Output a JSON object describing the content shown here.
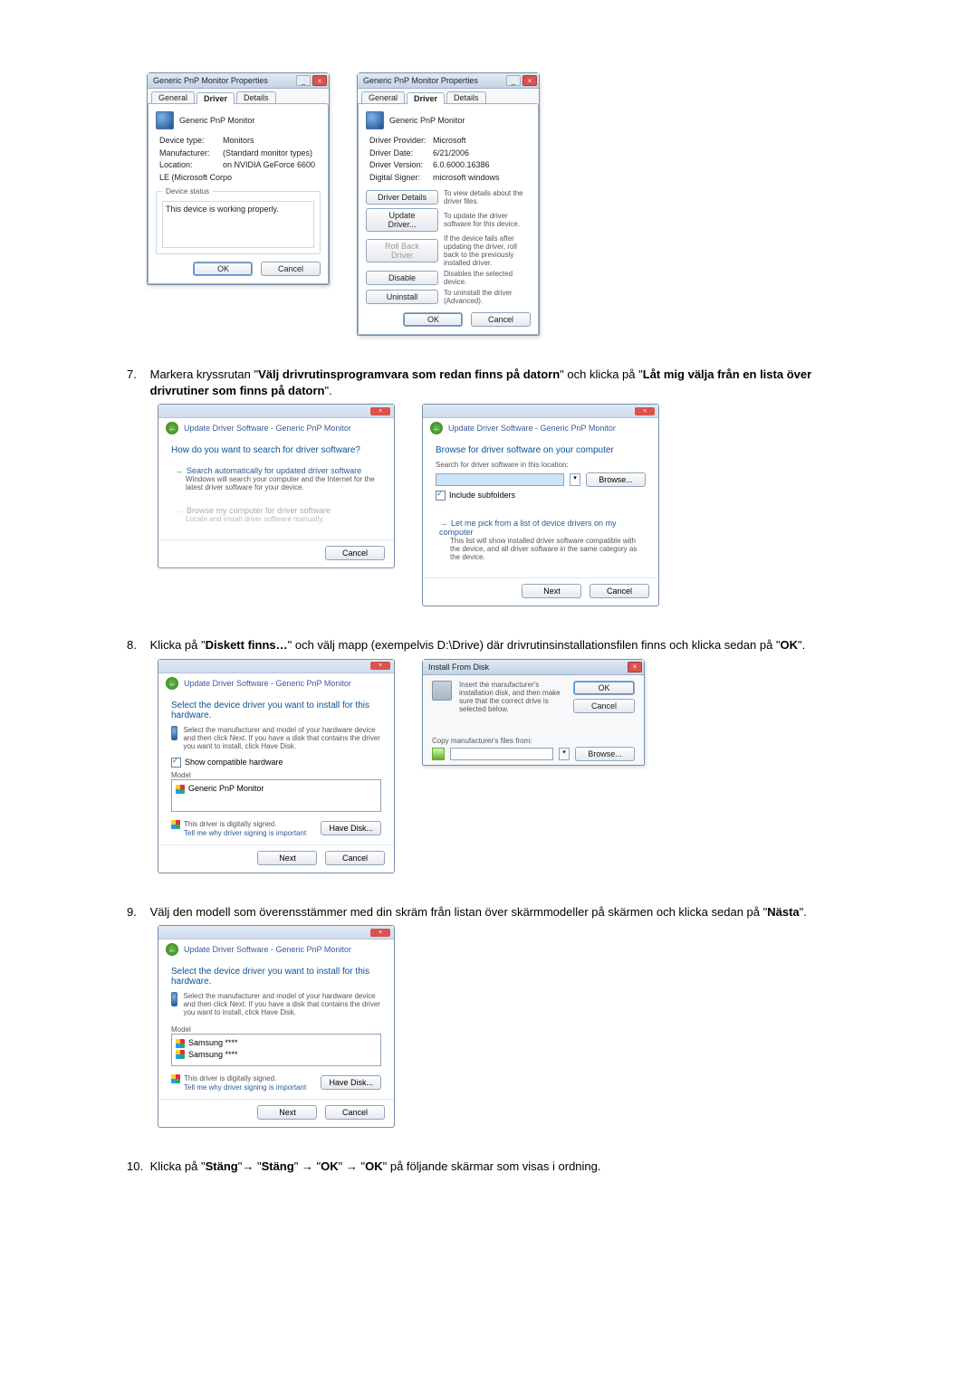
{
  "dlg_props": {
    "title": "Generic PnP Monitor Properties",
    "tabs": {
      "general": "General",
      "driver": "Driver",
      "details": "Details"
    },
    "header": "Generic PnP Monitor",
    "left": {
      "devtype_lbl": "Device type:",
      "devtype": "Monitors",
      "mfr_lbl": "Manufacturer:",
      "mfr": "(Standard monitor types)",
      "loc_lbl": "Location:",
      "loc": "on NVIDIA GeForce 6600 LE (Microsoft Corpo",
      "status_grp": "Device status",
      "status": "This device is working properly."
    },
    "right": {
      "prov_lbl": "Driver Provider:",
      "prov": "Microsoft",
      "date_lbl": "Driver Date:",
      "date": "6/21/2006",
      "ver_lbl": "Driver Version:",
      "ver": "6.0.6000.16386",
      "signer_lbl": "Digital Signer:",
      "signer": "microsoft windows",
      "btn_details": "Driver Details",
      "btn_details_desc": "To view details about the driver files.",
      "btn_update": "Update Driver...",
      "btn_update_desc": "To update the driver software for this device.",
      "btn_rollback": "Roll Back Driver",
      "btn_rollback_desc": "If the device fails after updating the driver, roll back to the previously installed driver.",
      "btn_disable": "Disable",
      "btn_disable_desc": "Disables the selected device.",
      "btn_uninstall": "Uninstall",
      "btn_uninstall_desc": "To uninstall the driver (Advanced)."
    },
    "ok": "OK",
    "cancel": "Cancel"
  },
  "step7": {
    "num": "7.",
    "text_a": "Markera kryssrutan \"",
    "bold_a": "Välj drivrutinsprogramvara som redan finns på datorn",
    "text_b": "\" och klicka på \"",
    "bold_b": "Låt mig välja från en lista över drivrutiner som finns på datorn",
    "text_c": "\"."
  },
  "wiz_left": {
    "crumb": "Update Driver Software - Generic PnP Monitor",
    "heading": "How do you want to search for driver software?",
    "opt1_title": "Search automatically for updated driver software",
    "opt1_desc": "Windows will search your computer and the Internet for the latest driver software for your device.",
    "opt2_title": "Browse my computer for driver software",
    "opt2_desc": "Locate and install driver software manually.",
    "cancel": "Cancel"
  },
  "wiz_right": {
    "crumb": "Update Driver Software - Generic PnP Monitor",
    "heading": "Browse for driver software on your computer",
    "search_lbl": "Search for driver software in this location:",
    "browse": "Browse...",
    "include": "Include subfolders",
    "opt_title": "Let me pick from a list of device drivers on my computer",
    "opt_desc": "This list will show installed driver software compatible with the device, and all driver software in the same category as the device.",
    "next": "Next",
    "cancel": "Cancel"
  },
  "step8": {
    "num": "8.",
    "text_a": "Klicka på \"",
    "bold_a": "Diskett finns…",
    "text_b": "\" och välj mapp (exempelvis D:\\Drive) där drivrutinsinstallationsfilen finns och klicka sedan på \"",
    "bold_b": "OK",
    "text_c": "\"."
  },
  "wiz_hw1": {
    "crumb": "Update Driver Software - Generic PnP Monitor",
    "heading": "Select the device driver you want to install for this hardware.",
    "desc": "Select the manufacturer and model of your hardware device and then click Next. If you have a disk that contains the driver you want to install, click Have Disk.",
    "showcompat": "Show compatible hardware",
    "model_lbl": "Model",
    "model_item": "Generic PnP Monitor",
    "signed": "This driver is digitally signed.",
    "tellwhy": "Tell me why driver signing is important",
    "havedisk": "Have Disk...",
    "next": "Next",
    "cancel": "Cancel"
  },
  "install_disk": {
    "title": "Install From Disk",
    "msg": "Insert the manufacturer's installation disk, and then make sure that the correct drive is selected below.",
    "ok": "OK",
    "cancel": "Cancel",
    "copy_lbl": "Copy manufacturer's files from:",
    "browse": "Browse..."
  },
  "step9": {
    "num": "9.",
    "text_a": "Välj den modell som överensstämmer med din skräm från listan över skärmmodeller på skärmen och klicka sedan på \"",
    "bold_a": "Nästa",
    "text_b": "\"."
  },
  "wiz_hw2": {
    "crumb": "Update Driver Software - Generic PnP Monitor",
    "heading": "Select the device driver you want to install for this hardware.",
    "desc": "Select the manufacturer and model of your hardware device and then click Next. If you have a disk that contains the driver you want to install, click Have Disk.",
    "model_lbl": "Model",
    "model_item1": "Samsung ****",
    "model_item2": "Samsung ****",
    "signed": "This driver is digitally signed.",
    "tellwhy": "Tell me why driver signing is important",
    "havedisk": "Have Disk...",
    "next": "Next",
    "cancel": "Cancel"
  },
  "step10": {
    "num": "10.",
    "text_a": "Klicka på \"",
    "b1": "Stäng",
    "arrow": "\"→ \"",
    "b2": "Stäng",
    "arrow2": "\" → \"",
    "b3": "OK",
    "arrow3": "\" → \"",
    "b4": "OK",
    "text_end": "\" på följande skärmar som visas i ordning."
  }
}
